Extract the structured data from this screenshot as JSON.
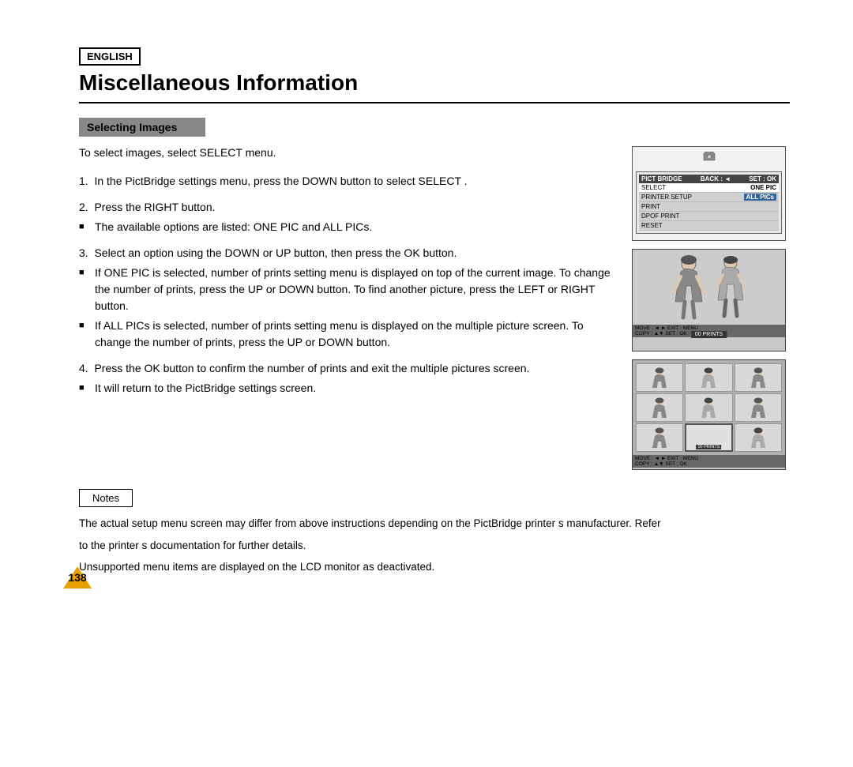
{
  "header": {
    "badge": "ENGLISH",
    "title": "Miscellaneous Information"
  },
  "section": {
    "heading": "Selecting Images",
    "intro": "To select images, select  SELECT  menu.",
    "steps": [
      {
        "number": "1.",
        "text": "In the PictBridge settings menu, press the DOWN button to select  SELECT ."
      },
      {
        "number": "2.",
        "text": "Press the RIGHT button.",
        "bullets": [
          "The available options are listed: ONE PIC and ALL PICs."
        ]
      },
      {
        "number": "3.",
        "text": "Select an option using the DOWN or UP button, then press the OK button.",
        "bullets": [
          "If  ONE PIC  is selected, number of prints setting menu is displayed on top of the current image. To change the number of prints, press the UP or DOWN button. To find another picture, press the LEFT or RIGHT button.",
          "If  ALL PICs  is selected, number of prints setting menu is displayed on the multiple picture screen. To change the number of prints, press the UP or DOWN button."
        ]
      },
      {
        "number": "4.",
        "text": "Press the OK button to confirm the number of prints and exit the multiple pictures screen.",
        "bullets": [
          "It will return to the PictBridge settings screen."
        ]
      }
    ]
  },
  "diagrams": {
    "menu": {
      "header_left": "PICT BRIDGE",
      "header_mid": "BACK : ◄",
      "header_right": "SET : OK",
      "rows": [
        {
          "label": "SELECT",
          "value": "ONE PIC",
          "highlight": true
        },
        {
          "label": "PRINTER SETUP",
          "value": "ALL PICs",
          "highlight": false
        },
        {
          "label": "PRINT",
          "value": "",
          "highlight": false
        },
        {
          "label": "DPOF PRINT",
          "value": "",
          "highlight": false
        },
        {
          "label": "RESET",
          "value": "",
          "highlight": false
        }
      ]
    },
    "single_screen": {
      "bottom_controls": "MOVE : ◄ ►    EXIT : MENU",
      "bottom_controls2": "COPY : ▲▼    SET : OK",
      "prints_label": "00  PRINTS"
    },
    "multi_screen": {
      "bottom_controls": "MOVE : ◄ ►    EXIT : MENU",
      "bottom_controls2": "COPY : ▲▼    SET : OK",
      "prints_label": "00  PRINTS"
    }
  },
  "notes": {
    "label": "Notes",
    "lines": [
      "The actual setup menu screen may differ from above instructions depending on the PictBridge printer s manufacturer. Refer",
      "to the printer s documentation for further details.",
      "Unsupported menu items are displayed on the LCD monitor as deactivated."
    ]
  },
  "page_number": "138"
}
